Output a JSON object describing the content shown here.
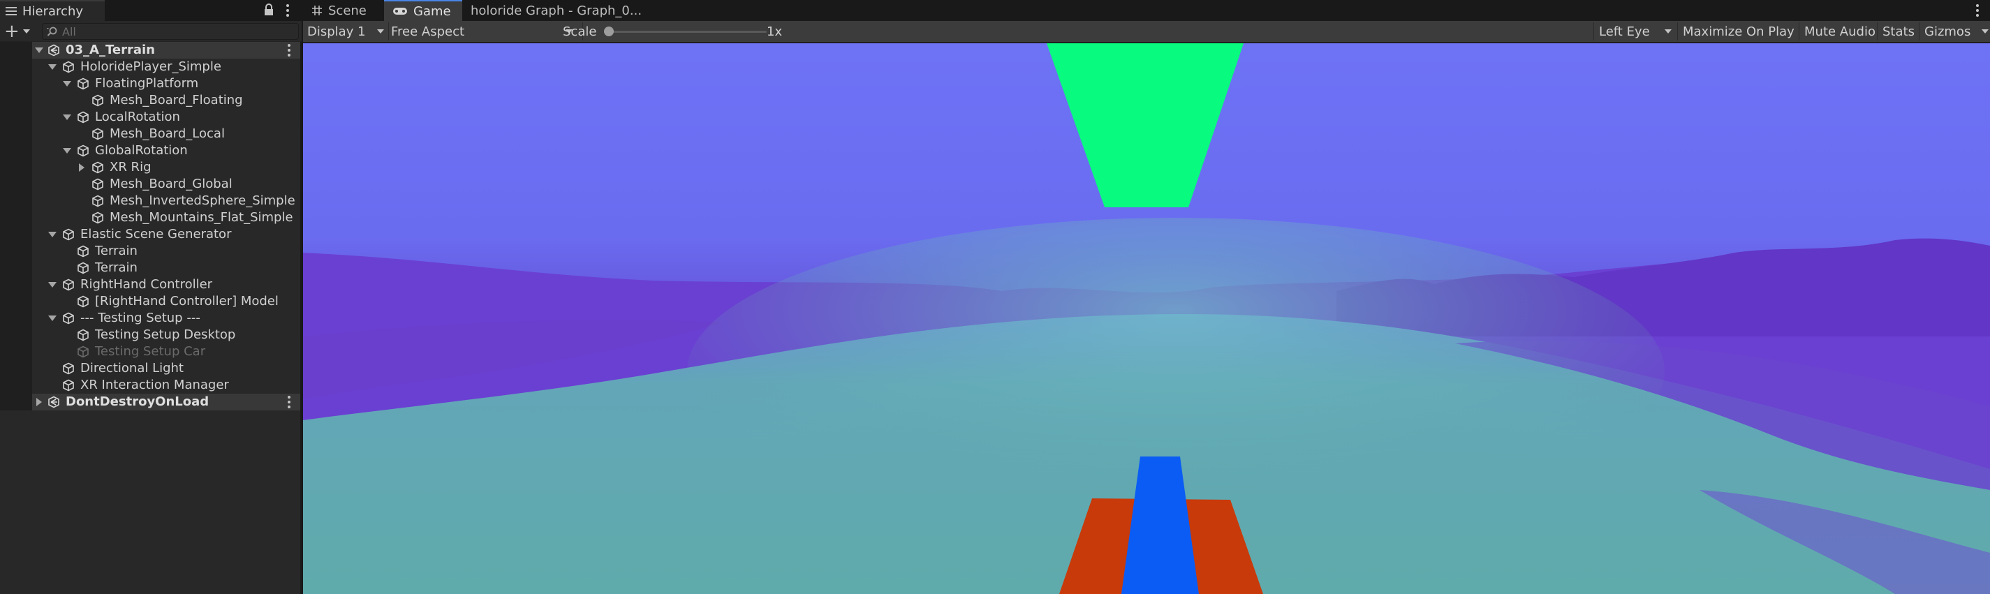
{
  "hierarchy": {
    "tab_label": "Hierarchy",
    "search_placeholder": "All",
    "tree": [
      {
        "label": "03_A_Terrain",
        "type": "scene",
        "depth": 0,
        "expand": "down"
      },
      {
        "label": "HoloridePlayer_Simple",
        "type": "object",
        "depth": 1,
        "expand": "down"
      },
      {
        "label": "FloatingPlatform",
        "type": "object",
        "depth": 2,
        "expand": "down"
      },
      {
        "label": "Mesh_Board_Floating",
        "type": "object",
        "depth": 3,
        "expand": "none"
      },
      {
        "label": "LocalRotation",
        "type": "object",
        "depth": 2,
        "expand": "down"
      },
      {
        "label": "Mesh_Board_Local",
        "type": "object",
        "depth": 3,
        "expand": "none"
      },
      {
        "label": "GlobalRotation",
        "type": "object",
        "depth": 2,
        "expand": "down"
      },
      {
        "label": "XR Rig",
        "type": "object",
        "depth": 3,
        "expand": "right"
      },
      {
        "label": "Mesh_Board_Global",
        "type": "object",
        "depth": 3,
        "expand": "none"
      },
      {
        "label": "Mesh_InvertedSphere_Simple",
        "type": "object",
        "depth": 3,
        "expand": "none"
      },
      {
        "label": "Mesh_Mountains_Flat_Simple",
        "type": "object",
        "depth": 3,
        "expand": "none"
      },
      {
        "label": "Elastic Scene Generator",
        "type": "object",
        "depth": 1,
        "expand": "down"
      },
      {
        "label": "Terrain",
        "type": "object",
        "depth": 2,
        "expand": "none"
      },
      {
        "label": "Terrain",
        "type": "object",
        "depth": 2,
        "expand": "none"
      },
      {
        "label": "RightHand Controller",
        "type": "object",
        "depth": 1,
        "expand": "down"
      },
      {
        "label": "[RightHand Controller] Model",
        "type": "object",
        "depth": 2,
        "expand": "none"
      },
      {
        "label": "--- Testing Setup ---",
        "type": "object",
        "depth": 1,
        "expand": "down"
      },
      {
        "label": "Testing Setup Desktop",
        "type": "object",
        "depth": 2,
        "expand": "none"
      },
      {
        "label": "Testing Setup Car",
        "type": "object",
        "depth": 2,
        "expand": "none",
        "disabled": true
      },
      {
        "label": "Directional Light",
        "type": "object",
        "depth": 1,
        "expand": "none"
      },
      {
        "label": "XR Interaction Manager",
        "type": "object",
        "depth": 1,
        "expand": "none"
      },
      {
        "label": "DontDestroyOnLoad",
        "type": "scene",
        "depth": 0,
        "expand": "right"
      }
    ]
  },
  "tabs": {
    "scene": "Scene",
    "game": "Game",
    "graph": "holoride Graph - Graph_0..."
  },
  "game_toolbar": {
    "display": "Display 1",
    "aspect": "Free Aspect",
    "scale_label": "Scale",
    "scale_value": "1x",
    "scale_level": 0.0,
    "eye": "Left Eye",
    "maximize": "Maximize On Play",
    "mute": "Mute Audio",
    "stats": "Stats",
    "gizmos": "Gizmos"
  },
  "colors": {
    "sky": "#6c6ef2",
    "ground": "#5fa9a8",
    "mountains": "#6a3fd0",
    "floating_board": "#08fb7e",
    "board_orange": "#c83a0a",
    "board_blue": "#0a5cf5",
    "active_tab_accent": "#4a86e8"
  }
}
